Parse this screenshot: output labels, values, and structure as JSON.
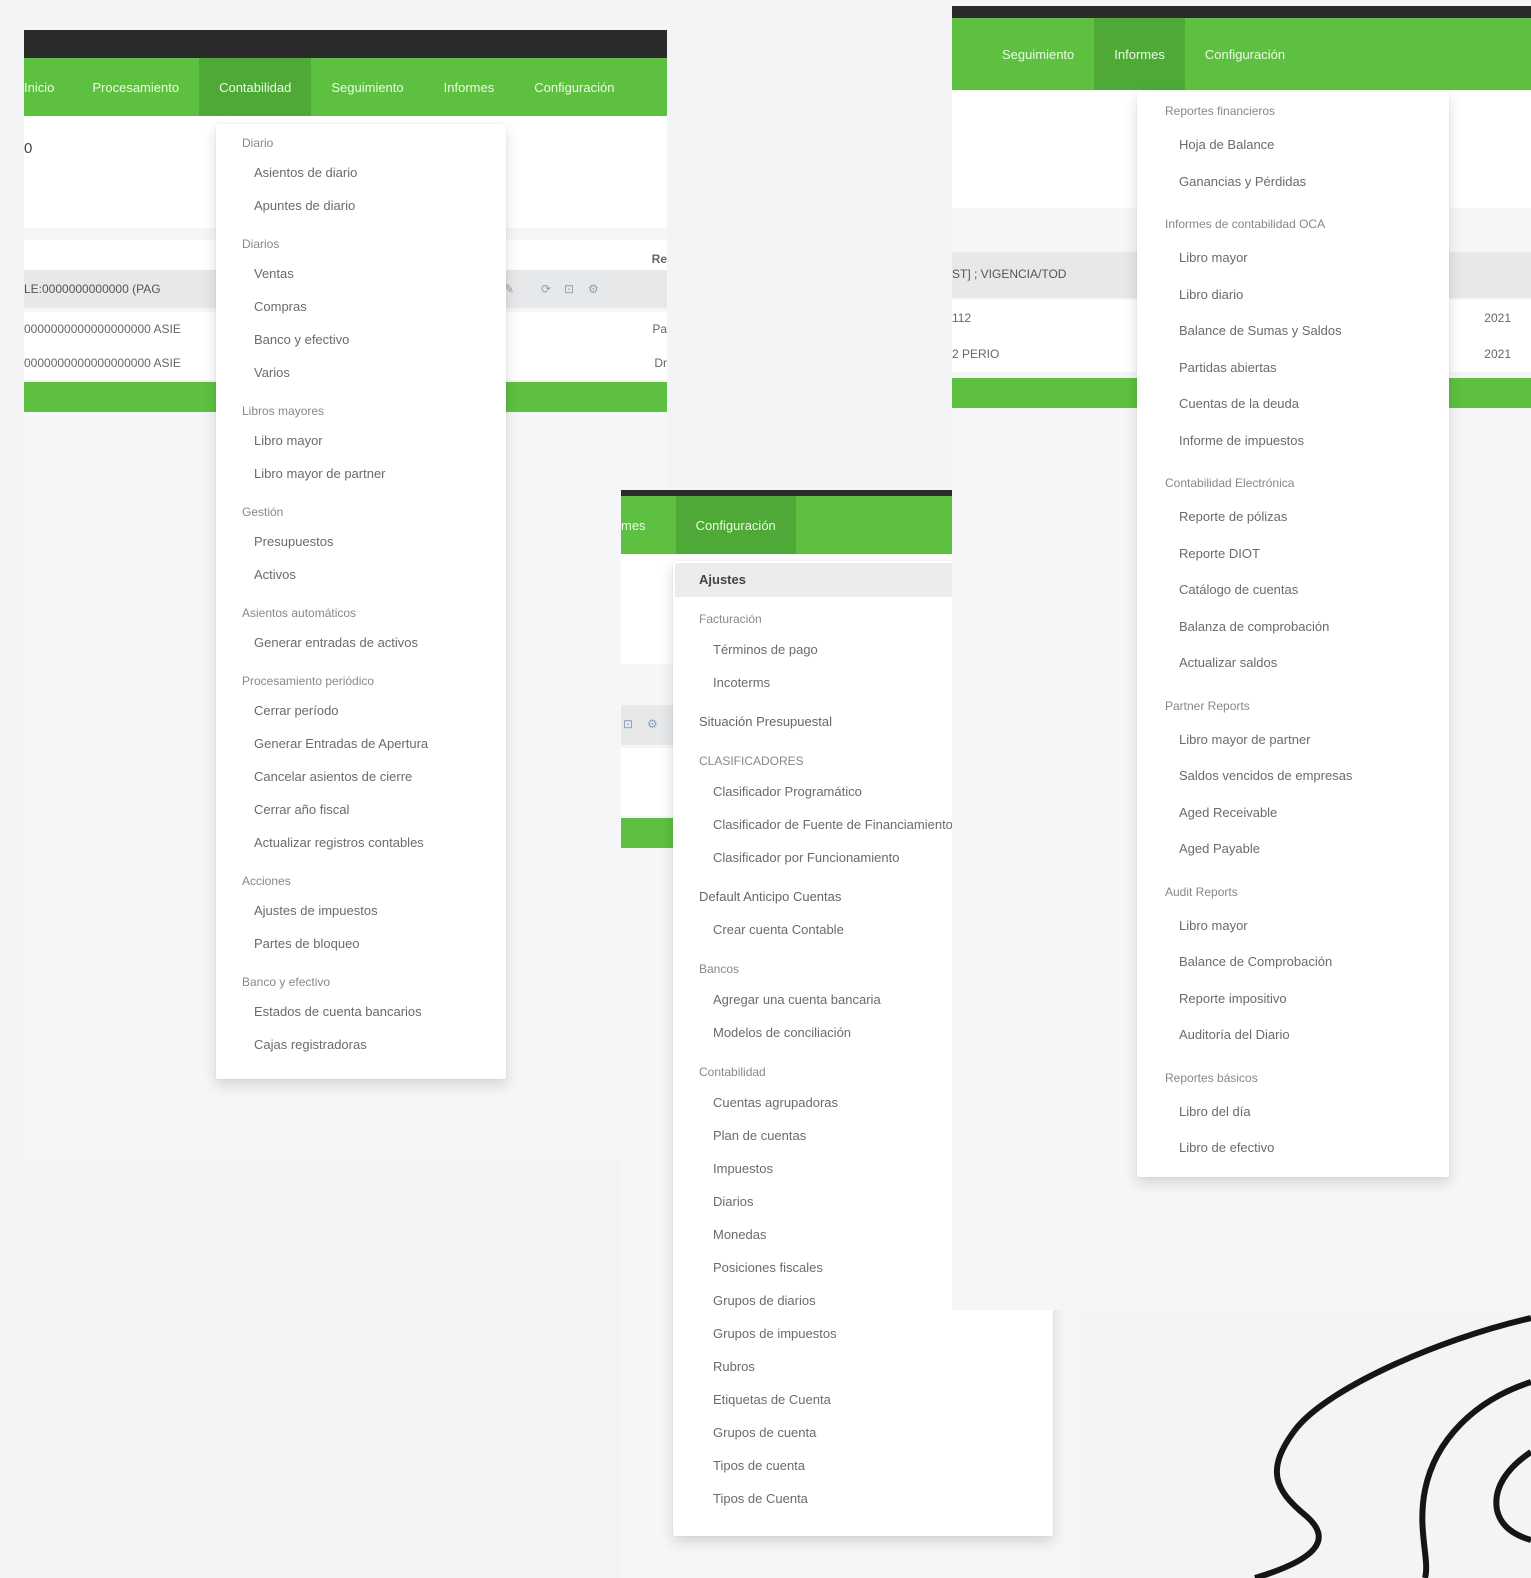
{
  "panel_left": {
    "nav_tabs": [
      {
        "label": "Inicio",
        "active": false
      },
      {
        "label": "Procesamiento",
        "active": false
      },
      {
        "label": "Contabilidad",
        "active": true
      },
      {
        "label": "Seguimiento",
        "active": false
      },
      {
        "label": "Informes",
        "active": false
      },
      {
        "label": "Configuración",
        "active": false
      }
    ],
    "page_char": "0",
    "table_header_right": "Re",
    "toolbar_text": "LE:0000000000000 (PAG",
    "row1_text": "0000000000000000000 ASIE",
    "row2_text": "0000000000000000000 ASIE",
    "row1_right": "Pa",
    "row2_right": "Dr",
    "toolbar_icons": [
      "edit-icon",
      "refresh-icon",
      "filter-icon",
      "settings-icon"
    ],
    "menu_items": [
      {
        "label": "Diario",
        "type": "header"
      },
      {
        "label": "Asientos de diario",
        "type": "item"
      },
      {
        "label": "Apuntes de diario",
        "type": "item"
      },
      {
        "label": "Diarios",
        "type": "header"
      },
      {
        "label": "Ventas",
        "type": "item"
      },
      {
        "label": "Compras",
        "type": "item"
      },
      {
        "label": "Banco y efectivo",
        "type": "item"
      },
      {
        "label": "Varios",
        "type": "item"
      },
      {
        "label": "Libros mayores",
        "type": "header"
      },
      {
        "label": "Libro mayor",
        "type": "item"
      },
      {
        "label": "Libro mayor de partner",
        "type": "item"
      },
      {
        "label": "Gestión",
        "type": "header"
      },
      {
        "label": "Presupuestos",
        "type": "item"
      },
      {
        "label": "Activos",
        "type": "item"
      },
      {
        "label": "Asientos automáticos",
        "type": "header"
      },
      {
        "label": "Generar entradas de activos",
        "type": "item"
      },
      {
        "label": "Procesamiento periódico",
        "type": "header"
      },
      {
        "label": "Cerrar período",
        "type": "item"
      },
      {
        "label": "Generar Entradas de Apertura",
        "type": "item"
      },
      {
        "label": "Cancelar asientos de cierre",
        "type": "item"
      },
      {
        "label": "Cerrar año fiscal",
        "type": "item"
      },
      {
        "label": "Actualizar registros contables",
        "type": "item"
      },
      {
        "label": "Acciones",
        "type": "header"
      },
      {
        "label": "Ajustes de impuestos",
        "type": "item"
      },
      {
        "label": "Partes de bloqueo",
        "type": "item"
      },
      {
        "label": "Banco y efectivo",
        "type": "header"
      },
      {
        "label": "Estados de cuenta bancarios",
        "type": "item"
      },
      {
        "label": "Cajas registradoras",
        "type": "item"
      }
    ]
  },
  "panel_middle": {
    "nav_tabs": [
      {
        "label": "mes",
        "active": false
      },
      {
        "label": "Configuración",
        "active": true
      }
    ],
    "toolbar_icons": [
      "filter-icon",
      "settings-icon"
    ],
    "menu_items": [
      {
        "label": "Ajustes",
        "type": "highlight"
      },
      {
        "label": "Facturación",
        "type": "header"
      },
      {
        "label": "Términos de pago",
        "type": "item"
      },
      {
        "label": "Incoterms",
        "type": "item"
      },
      {
        "label": "Situación Presupuestal",
        "type": "subheader"
      },
      {
        "label": "CLASIFICADORES",
        "type": "header"
      },
      {
        "label": "Clasificador Programático",
        "type": "item"
      },
      {
        "label": "Clasificador de Fuente de Financiamiento",
        "type": "item"
      },
      {
        "label": "Clasificador por Funcionamiento",
        "type": "item"
      },
      {
        "label": "Default Anticipo Cuentas",
        "type": "subheader"
      },
      {
        "label": "Crear cuenta Contable",
        "type": "item"
      },
      {
        "label": "Bancos",
        "type": "header"
      },
      {
        "label": "Agregar una cuenta bancaria",
        "type": "item"
      },
      {
        "label": "Modelos de conciliación",
        "type": "item"
      },
      {
        "label": "Contabilidad",
        "type": "header"
      },
      {
        "label": "Cuentas agrupadoras",
        "type": "item"
      },
      {
        "label": "Plan de cuentas",
        "type": "item"
      },
      {
        "label": "Impuestos",
        "type": "item"
      },
      {
        "label": "Diarios",
        "type": "item"
      },
      {
        "label": "Monedas",
        "type": "item"
      },
      {
        "label": "Posiciones fiscales",
        "type": "item"
      },
      {
        "label": "Grupos de diarios",
        "type": "item"
      },
      {
        "label": "Grupos de impuestos",
        "type": "item"
      },
      {
        "label": "Rubros",
        "type": "item"
      },
      {
        "label": "Etiquetas de Cuenta",
        "type": "item"
      },
      {
        "label": "Grupos de cuenta",
        "type": "item"
      },
      {
        "label": "Tipos de cuenta",
        "type": "item"
      },
      {
        "label": "Tipos de Cuenta",
        "type": "item"
      }
    ]
  },
  "panel_right": {
    "nav_tabs": [
      {
        "label": "Seguimiento",
        "active": false
      },
      {
        "label": "Informes",
        "active": true
      },
      {
        "label": "Configuración",
        "active": false
      }
    ],
    "row_header_text": "ST] ; VIGENCIA/TOD",
    "row1_text": "112",
    "row2_text": "2 PERIO",
    "row1_right": "2021",
    "row2_right": "2021",
    "menu_items": [
      {
        "label": "Reportes financieros",
        "type": "header"
      },
      {
        "label": "Hoja de Balance",
        "type": "item"
      },
      {
        "label": "Ganancias y Pérdidas",
        "type": "item"
      },
      {
        "label": "Informes de contabilidad OCA",
        "type": "header"
      },
      {
        "label": "Libro mayor",
        "type": "item"
      },
      {
        "label": "Libro diario",
        "type": "item"
      },
      {
        "label": "Balance de Sumas y Saldos",
        "type": "item"
      },
      {
        "label": "Partidas abiertas",
        "type": "item"
      },
      {
        "label": "Cuentas de la deuda",
        "type": "item"
      },
      {
        "label": "Informe de impuestos",
        "type": "item"
      },
      {
        "label": "Contabilidad Electrónica",
        "type": "header"
      },
      {
        "label": "Reporte de pólizas",
        "type": "item"
      },
      {
        "label": "Reporte DIOT",
        "type": "item"
      },
      {
        "label": "Catálogo de cuentas",
        "type": "item"
      },
      {
        "label": "Balanza de comprobación",
        "type": "item"
      },
      {
        "label": "Actualizar saldos",
        "type": "item"
      },
      {
        "label": "Partner Reports",
        "type": "header"
      },
      {
        "label": "Libro mayor de partner",
        "type": "item"
      },
      {
        "label": "Saldos vencidos de empresas",
        "type": "item"
      },
      {
        "label": "Aged Receivable",
        "type": "item"
      },
      {
        "label": "Aged Payable",
        "type": "item"
      },
      {
        "label": "Audit Reports",
        "type": "header"
      },
      {
        "label": "Libro mayor",
        "type": "item"
      },
      {
        "label": "Balance de Comprobación",
        "type": "item"
      },
      {
        "label": "Reporte impositivo",
        "type": "item"
      },
      {
        "label": "Auditoría del Diario",
        "type": "item"
      },
      {
        "label": "Reportes básicos",
        "type": "header"
      },
      {
        "label": "Libro del día",
        "type": "item"
      },
      {
        "label": "Libro de efectivo",
        "type": "item"
      }
    ]
  },
  "colors": {
    "nav_green": "#5ec040",
    "nav_green_active": "#4ea936",
    "dark_strip": "#2b2b2b",
    "dropdown_bg": "#ffffff"
  }
}
